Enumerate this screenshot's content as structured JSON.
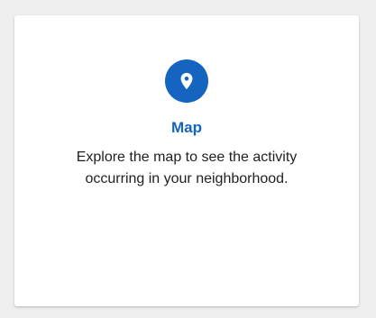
{
  "colors": {
    "accent": "#1565c0",
    "background": "#efefef",
    "card": "#ffffff",
    "text": "#1f1f1f"
  },
  "card": {
    "icon": "map-pin-icon",
    "title": "Map",
    "description_lines": [
      "Explore the map to see the activity",
      "occurring in your neighborhood."
    ]
  }
}
